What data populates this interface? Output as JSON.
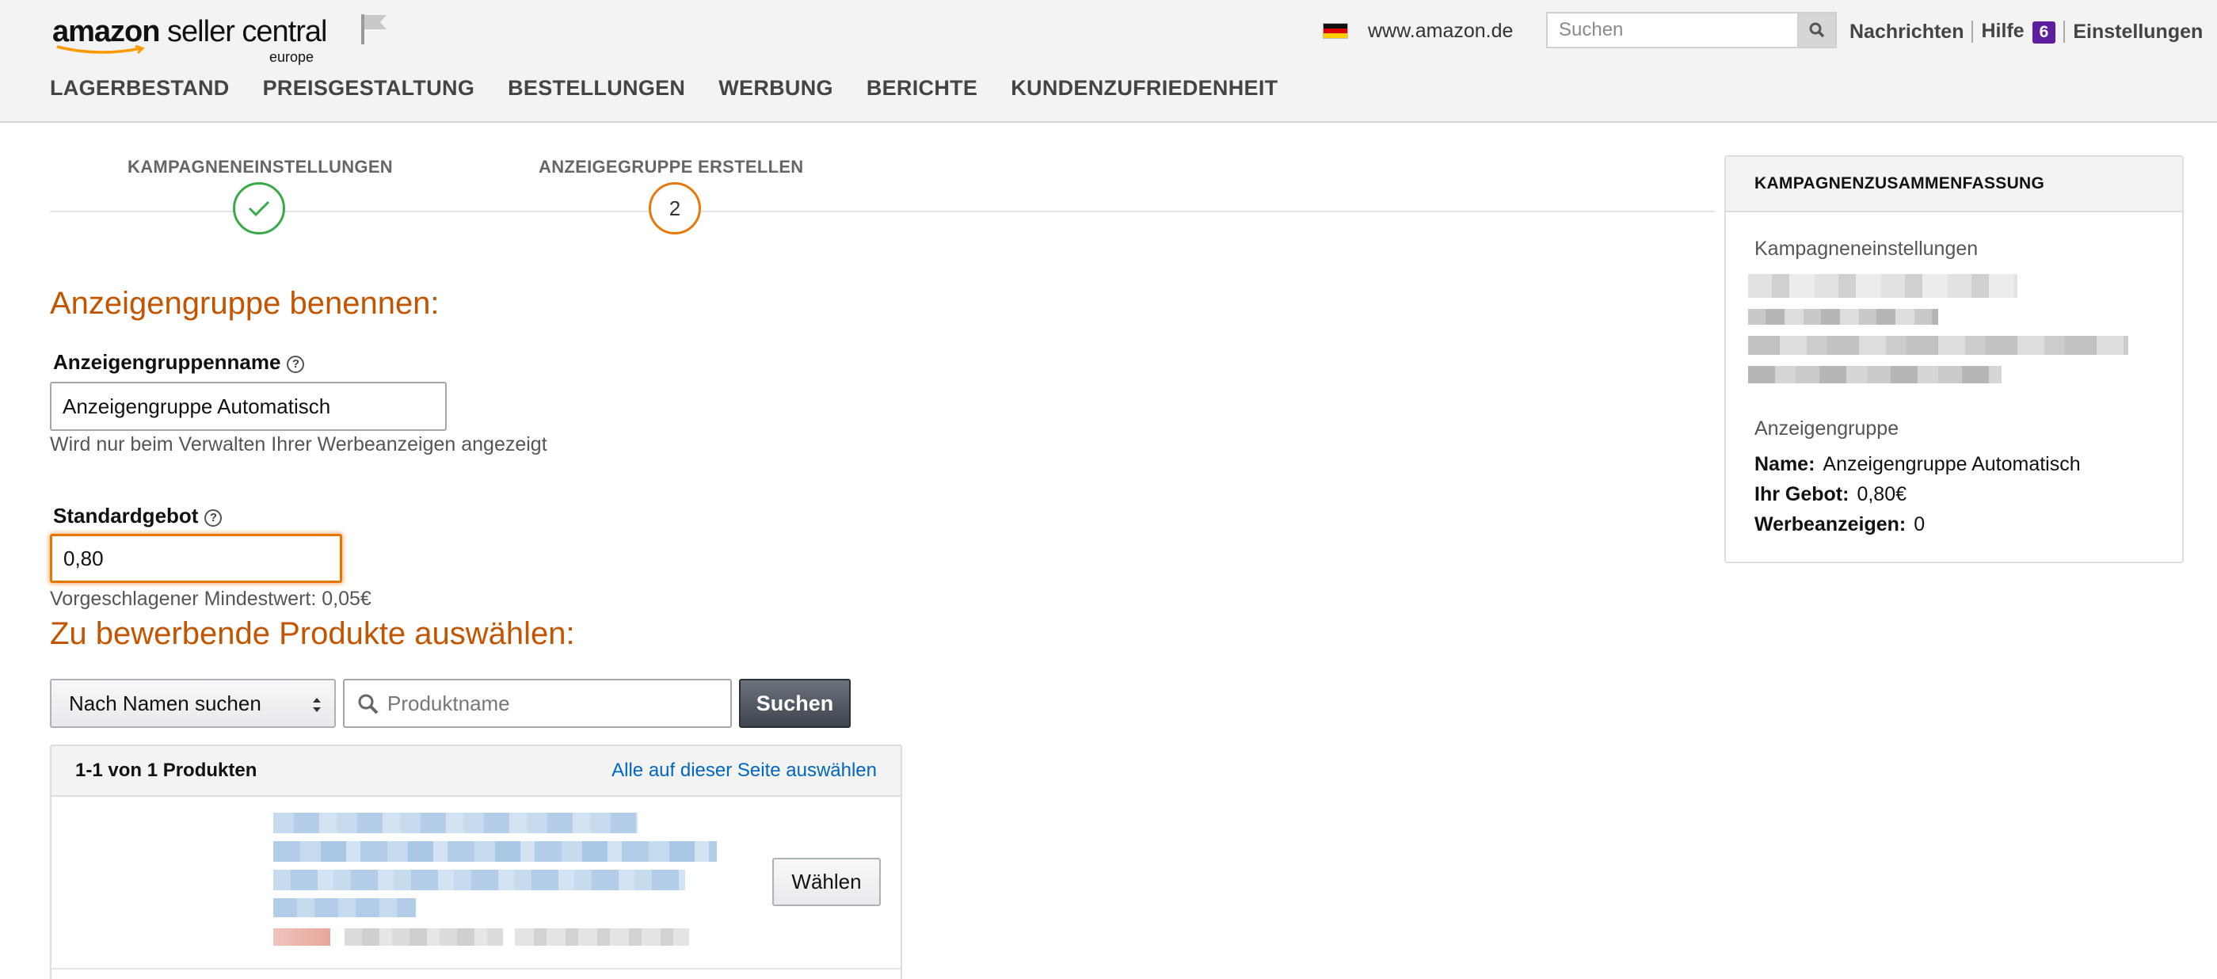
{
  "header": {
    "logo_brand": "amazon",
    "logo_suffix": "seller central",
    "logo_region": "europe",
    "marketplace": "www.amazon.de",
    "search_placeholder": "Suchen",
    "links": {
      "messages": "Nachrichten",
      "help": "Hilfe",
      "help_badge": "6",
      "settings": "Einstellungen"
    },
    "nav": [
      "LAGERBESTAND",
      "PREISGESTALTUNG",
      "BESTELLUNGEN",
      "WERBUNG",
      "BERICHTE",
      "KUNDENZUFRIEDENHEIT"
    ]
  },
  "steps": {
    "step1_label": "KAMPAGNENEINSTELLUNGEN",
    "step2_label": "ANZEIGEGRUPPE ERSTELLEN",
    "step2_number": "2"
  },
  "form": {
    "title": "Anzeigengruppe benennen:",
    "name_label": "Anzeigengruppenname",
    "name_value": "Anzeigengruppe Automatisch",
    "name_hint": "Wird nur beim Verwalten Ihrer Werbeanzeigen angezeigt",
    "bid_label": "Standardgebot",
    "bid_value": "0,80",
    "bid_hint": "Vorgeschlagener Mindestwert: 0,05€",
    "help_glyph": "?"
  },
  "products": {
    "title": "Zu bewerbende Produkte auswählen:",
    "search_mode": "Nach Namen suchen",
    "search_placeholder": "Produktname",
    "search_button": "Suchen",
    "results_count": "1-1 von 1 Produkten",
    "select_all": "Alle auf dieser Seite auswählen",
    "choose_button": "Wählen"
  },
  "summary": {
    "title": "KAMPAGNENZUSAMMENFASSUNG",
    "campaign_settings_label": "Kampagneneinstellungen",
    "adgroup_label": "Anzeigengruppe",
    "name_key": "Name:",
    "name_value": "Anzeigengruppe Automatisch",
    "bid_key": "Ihr Gebot:",
    "bid_value": "0,80€",
    "ads_key": "Werbeanzeigen:",
    "ads_value": "0"
  },
  "colors": {
    "accent_orange": "#c45500",
    "step_done_green": "#3aa948",
    "step_active_orange": "#e8780c",
    "link_blue": "#0066c0",
    "badge_purple": "#5f1ea0"
  }
}
